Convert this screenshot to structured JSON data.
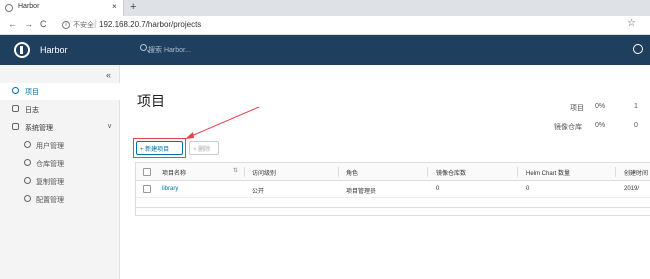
{
  "browser": {
    "tab_title": "Harbor",
    "tab_close": "×",
    "new_tab": "+",
    "back": "←",
    "forward": "→",
    "reload": "C",
    "info_icon_glyph": "i",
    "insecure_label": "不安全",
    "separator": "|",
    "url": "192.168.20.7/harbor/projects",
    "bookmark": "☆"
  },
  "header": {
    "brand": "Harbor",
    "search_placeholder": "搜索 Harbor...",
    "bg_color": "#1f3f5f"
  },
  "sidebar": {
    "collapse": "«",
    "items": [
      {
        "label": "项目",
        "icon": "projects-icon",
        "active": true
      },
      {
        "label": "日志",
        "icon": "logs-icon"
      },
      {
        "label": "系统管理",
        "icon": "admin-icon",
        "expandable": true,
        "chevron": "∨"
      },
      {
        "label": "用户管理",
        "icon": "users-icon",
        "sub": true
      },
      {
        "label": "仓库管理",
        "icon": "registries-icon",
        "sub": true
      },
      {
        "label": "复制管理",
        "icon": "replication-icon",
        "sub": true
      },
      {
        "label": "配置管理",
        "icon": "config-icon",
        "sub": true
      }
    ]
  },
  "main": {
    "title": "项目",
    "stats": [
      {
        "label": "项目",
        "value": "0%",
        "extra": "1"
      },
      {
        "label": "镜像仓库",
        "value": "0%",
        "extra": "0"
      }
    ],
    "new_project_label": "+ 新建项目",
    "delete_label": "× 删除",
    "table": {
      "columns": [
        "项目名称",
        "访问级别",
        "角色",
        "镜像仓库数",
        "Helm Chart 数量",
        "创建时间"
      ],
      "sort_glyph": "⇅",
      "rows": [
        {
          "name": "library",
          "access": "公开",
          "role": "项目管理员",
          "repos": "0",
          "charts": "0",
          "created": "2019/"
        }
      ]
    }
  },
  "colors": {
    "accent": "#0072a3",
    "highlight": "#e8424e"
  }
}
